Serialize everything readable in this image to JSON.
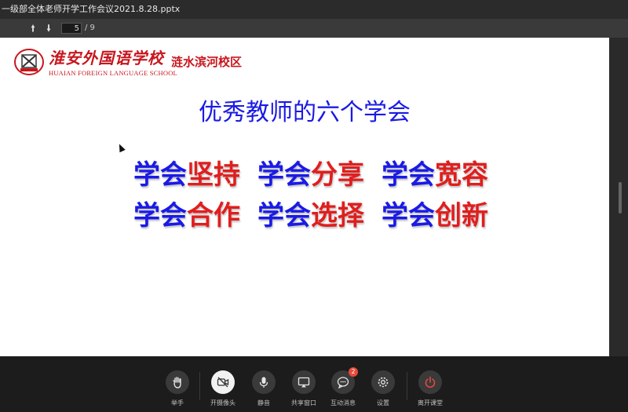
{
  "window": {
    "title": "一级部全体老师开学工作会议2021.8.28.pptx"
  },
  "toolbar": {
    "prev_icon": "arrow-up-icon",
    "next_icon": "arrow-down-icon",
    "current_page": "5",
    "total_pages": "/ 9"
  },
  "slide": {
    "school_cn": "淮安外国语学校",
    "school_en": "HUAIAN FOREIGN LANGUAGE SCHOOL",
    "campus": "涟水滨河校区",
    "title": "优秀教师的六个学会",
    "rows": [
      [
        {
          "prefix": "学会",
          "word": "坚持"
        },
        {
          "prefix": "学会",
          "word": "分享"
        },
        {
          "prefix": "学会",
          "word": "宽容"
        }
      ],
      [
        {
          "prefix": "学会",
          "word": "合作"
        },
        {
          "prefix": "学会",
          "word": "选择"
        },
        {
          "prefix": "学会",
          "word": "创新"
        }
      ]
    ],
    "colors": {
      "blue": "#1a1ae6",
      "red": "#e01e1e",
      "brand": "#c8161d"
    }
  },
  "controls": {
    "raise_hand": {
      "label": "举手",
      "icon": "hand-icon"
    },
    "camera": {
      "label": "开摄像头",
      "icon": "camera-off-icon"
    },
    "mute": {
      "label": "静音",
      "icon": "microphone-icon"
    },
    "share": {
      "label": "共享窗口",
      "icon": "screen-share-icon"
    },
    "messages": {
      "label": "互动消息",
      "icon": "chat-icon",
      "badge": "2"
    },
    "settings": {
      "label": "设置",
      "icon": "gear-icon"
    },
    "leave": {
      "label": "离开课堂",
      "icon": "power-icon",
      "color": "#e84a3a"
    }
  }
}
